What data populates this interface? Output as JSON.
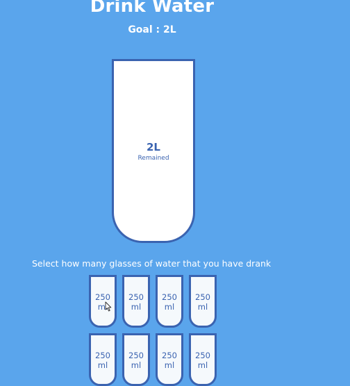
{
  "header": {
    "title": "Drink Water",
    "goal": "Goal : 2L"
  },
  "big_cup": {
    "remained_amount": "2L",
    "remained_label": "Remained"
  },
  "instruction": "Select how many glasses of water that you have drank",
  "small_cups": [
    {
      "label": "250\nml"
    },
    {
      "label": "250\nml"
    },
    {
      "label": "250\nml"
    },
    {
      "label": "250\nml"
    },
    {
      "label": "250\nml"
    },
    {
      "label": "250\nml"
    },
    {
      "label": "250\nml"
    },
    {
      "label": "250\nml"
    }
  ],
  "colors": {
    "background": "#5aa5ec",
    "accent": "#3a63b0",
    "cup_fill": "#ffffff",
    "small_cup_fill": "#f5f9fc"
  }
}
